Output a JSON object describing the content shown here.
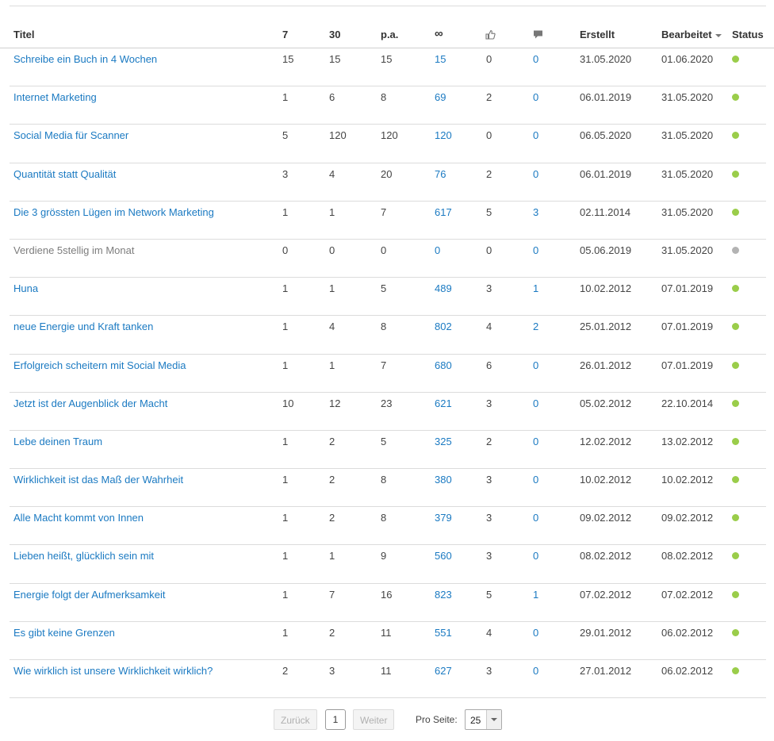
{
  "columns": {
    "title": "Titel",
    "d7": "7",
    "d30": "30",
    "pa": "p.a.",
    "inf": "∞",
    "likes_icon": "thumbs-up-icon",
    "comments_icon": "comment-icon",
    "created": "Erstellt",
    "edited": "Bearbeitet",
    "status": "Status"
  },
  "rows": [
    {
      "title": "Schreibe ein Buch in 4 Wochen",
      "d7": "15",
      "d30": "15",
      "pa": "15",
      "total": "15",
      "likes": "0",
      "comments": "0",
      "created": "31.05.2020",
      "edited": "01.06.2020",
      "status": "active"
    },
    {
      "title": "Internet Marketing",
      "d7": "1",
      "d30": "6",
      "pa": "8",
      "total": "69",
      "likes": "2",
      "comments": "0",
      "created": "06.01.2019",
      "edited": "31.05.2020",
      "status": "active"
    },
    {
      "title": "Social Media für Scanner",
      "d7": "5",
      "d30": "120",
      "pa": "120",
      "total": "120",
      "likes": "0",
      "comments": "0",
      "created": "06.05.2020",
      "edited": "31.05.2020",
      "status": "active"
    },
    {
      "title": "Quantität statt Qualität",
      "d7": "3",
      "d30": "4",
      "pa": "20",
      "total": "76",
      "likes": "2",
      "comments": "0",
      "created": "06.01.2019",
      "edited": "31.05.2020",
      "status": "active"
    },
    {
      "title": "Die 3 grössten Lügen im Network Marketing",
      "d7": "1",
      "d30": "1",
      "pa": "7",
      "total": "617",
      "likes": "5",
      "comments": "3",
      "created": "02.11.2014",
      "edited": "31.05.2020",
      "status": "active"
    },
    {
      "title": "Verdiene 5stellig im Monat",
      "d7": "0",
      "d30": "0",
      "pa": "0",
      "total": "0",
      "likes": "0",
      "comments": "0",
      "created": "05.06.2019",
      "edited": "31.05.2020",
      "status": "inactive"
    },
    {
      "title": "Huna",
      "d7": "1",
      "d30": "1",
      "pa": "5",
      "total": "489",
      "likes": "3",
      "comments": "1",
      "created": "10.02.2012",
      "edited": "07.01.2019",
      "status": "active"
    },
    {
      "title": "neue Energie und Kraft tanken",
      "d7": "1",
      "d30": "4",
      "pa": "8",
      "total": "802",
      "likes": "4",
      "comments": "2",
      "created": "25.01.2012",
      "edited": "07.01.2019",
      "status": "active"
    },
    {
      "title": "Erfolgreich scheitern mit Social Media",
      "d7": "1",
      "d30": "1",
      "pa": "7",
      "total": "680",
      "likes": "6",
      "comments": "0",
      "created": "26.01.2012",
      "edited": "07.01.2019",
      "status": "active"
    },
    {
      "title": "Jetzt ist der Augenblick der Macht",
      "d7": "10",
      "d30": "12",
      "pa": "23",
      "total": "621",
      "likes": "3",
      "comments": "0",
      "created": "05.02.2012",
      "edited": "22.10.2014",
      "status": "active"
    },
    {
      "title": "Lebe deinen Traum",
      "d7": "1",
      "d30": "2",
      "pa": "5",
      "total": "325",
      "likes": "2",
      "comments": "0",
      "created": "12.02.2012",
      "edited": "13.02.2012",
      "status": "active"
    },
    {
      "title": "Wirklichkeit ist das Maß der Wahrheit",
      "d7": "1",
      "d30": "2",
      "pa": "8",
      "total": "380",
      "likes": "3",
      "comments": "0",
      "created": "10.02.2012",
      "edited": "10.02.2012",
      "status": "active"
    },
    {
      "title": "Alle Macht kommt von Innen",
      "d7": "1",
      "d30": "2",
      "pa": "8",
      "total": "379",
      "likes": "3",
      "comments": "0",
      "created": "09.02.2012",
      "edited": "09.02.2012",
      "status": "active"
    },
    {
      "title": "Lieben heißt, glücklich sein mit",
      "d7": "1",
      "d30": "1",
      "pa": "9",
      "total": "560",
      "likes": "3",
      "comments": "0",
      "created": "08.02.2012",
      "edited": "08.02.2012",
      "status": "active"
    },
    {
      "title": "Energie folgt der Aufmerksamkeit",
      "d7": "1",
      "d30": "7",
      "pa": "16",
      "total": "823",
      "likes": "5",
      "comments": "1",
      "created": "07.02.2012",
      "edited": "07.02.2012",
      "status": "active"
    },
    {
      "title": "Es gibt keine Grenzen",
      "d7": "1",
      "d30": "2",
      "pa": "11",
      "total": "551",
      "likes": "4",
      "comments": "0",
      "created": "29.01.2012",
      "edited": "06.02.2012",
      "status": "active"
    },
    {
      "title": "Wie wirklich ist unsere Wirklichkeit wirklich?",
      "d7": "2",
      "d30": "3",
      "pa": "11",
      "total": "627",
      "likes": "3",
      "comments": "0",
      "created": "27.01.2012",
      "edited": "06.02.2012",
      "status": "active"
    }
  ],
  "colors": {
    "link": "#1b7ac2",
    "status_active": "#9acd4a",
    "status_inactive": "#b3b3b3"
  },
  "pagination": {
    "prev_label": "Zurück",
    "page": "1",
    "next_label": "Weiter",
    "per_page_label": "Pro Seite:",
    "per_page_value": "25"
  }
}
